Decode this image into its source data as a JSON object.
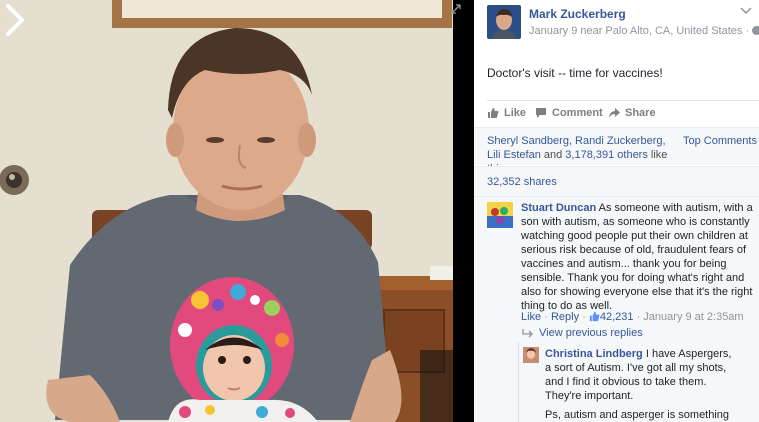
{
  "post": {
    "author": "Mark Zuckerberg",
    "meta": "January 9 near Palo Alto, CA, United States ·",
    "text": "Doctor's visit -- time for vaccines!"
  },
  "actions": {
    "like": "Like",
    "comment": "Comment",
    "share": "Share"
  },
  "likes": {
    "names": "Sheryl Sandberg, Randi Zuckerberg, Lili Estefan",
    "and": " and ",
    "others": "3,178,391 others",
    "suffix": " like this.",
    "top_comments": "Top Comments ▾"
  },
  "shares": "32,352 shares",
  "comments": [
    {
      "name": "Stuart Duncan",
      "text": " As someone with autism, with a son with autism, as someone who is constantly watching good people put their own children at serious risk because of old, fraudulent fears of vaccines and autism... thank you for being sensible. Thank you for doing what's right and also for showing everyone else that it's the right thing to do as well.",
      "like": "Like",
      "sep": " · ",
      "reply": "Reply",
      "like_count": "42,231",
      "time": " · January 9 at 2:35am"
    }
  ],
  "view_previous": "View previous replies",
  "reply": {
    "name": "Christina Lindberg",
    "text": " I have Aspergers, a sort of Autism. I've got all my shots, and I find it obvious to take them. They're important.",
    "text2": "Ps, autism and asperger is something"
  },
  "colors": {
    "link": "#365899",
    "meta": "#90949c",
    "panel": "#f6f7f9"
  }
}
